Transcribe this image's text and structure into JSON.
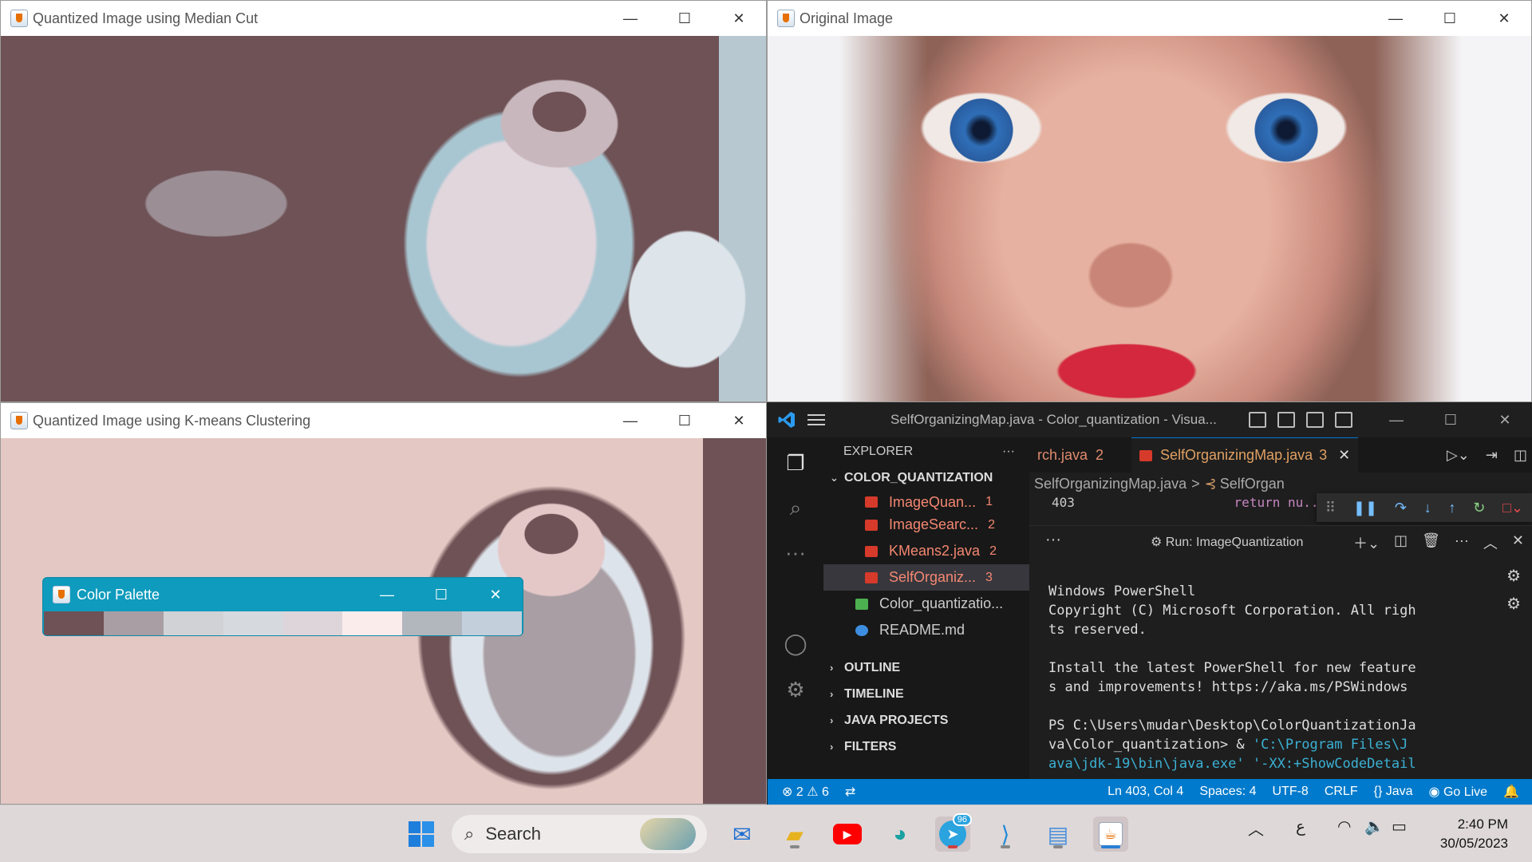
{
  "windows": {
    "median": {
      "title": "Quantized Image using Median Cut"
    },
    "original": {
      "title": "Original Image"
    },
    "kmeans": {
      "title": "Quantized Image using K-means Clustering"
    },
    "palette": {
      "title": "Color Palette",
      "swatches": [
        "#6e5256",
        "#a89ea3",
        "#d0d2d6",
        "#d6d9de",
        "#ddd5da",
        "#fbecec",
        "#b2b6bd",
        "#c3cfdb"
      ]
    }
  },
  "vscode": {
    "title": "SelfOrganizingMap.java - Color_quantization - Visua...",
    "explorer": {
      "header": "EXPLORER",
      "header_dots": "···",
      "project": "COLOR_QUANTIZATION",
      "files": [
        {
          "name": "ImageQuan...",
          "count": "1"
        },
        {
          "name": "ImageSearc...",
          "count": "2"
        },
        {
          "name": "KMeans2.java",
          "count": "2"
        },
        {
          "name": "SelfOrganiz...",
          "count": "3"
        },
        {
          "name": "Color_quantizatio...",
          "count": ""
        },
        {
          "name": "README.md",
          "count": ""
        }
      ],
      "sections": [
        "OUTLINE",
        "TIMELINE",
        "JAVA PROJECTS",
        "FILTERS"
      ]
    },
    "tabs": [
      {
        "label": "rch.java",
        "count": "2"
      },
      {
        "label": "SelfOrganizingMap.java",
        "count": "3"
      }
    ],
    "breadcrumb": {
      "file": "SelfOrganizingMap.java",
      "sep": ">",
      "symbol": "SelfOrgan"
    },
    "code": {
      "line_number": "403",
      "text": "return nu..."
    },
    "panel": {
      "dots": "···",
      "run_label": "Run: ImageQuantization",
      "terminal": [
        "Windows PowerShell",
        "Copyright (C) Microsoft Corporation. All righ",
        "ts reserved.",
        "",
        "Install the latest PowerShell for new feature",
        "s and improvements! https://aka.ms/PSWindows",
        "",
        "PS C:\\Users\\mudar\\Desktop\\ColorQuantizationJa",
        "va\\Color_quantization>  & ",
        "ava\\jdk-19\\bin\\java.exe' '-XX:+ShowCodeDetail"
      ],
      "terminal_cyan": "'C:\\Program Files\\J"
    },
    "status": {
      "errors": "2",
      "warnings": "6",
      "position": "Ln 403, Col 4",
      "spaces": "Spaces: 4",
      "encoding": "UTF-8",
      "eol": "CRLF",
      "language": "Java",
      "golive": "Go Live"
    }
  },
  "taskbar": {
    "search_label": "Search",
    "telegram_badge": "96",
    "lang": "ع",
    "time": "2:40 PM",
    "date": "30/05/2023"
  }
}
